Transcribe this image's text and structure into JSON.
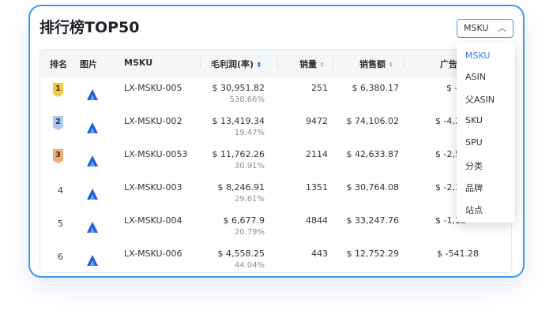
{
  "title": "排行榜TOP50",
  "selector": {
    "value": "MSKU"
  },
  "columns": {
    "rank": "排名",
    "image": "图片",
    "msku": "MSKU",
    "margin": "毛利润(率)",
    "qty": "销量",
    "sales": "销售额",
    "ad": "广告"
  },
  "rows": [
    {
      "rank": "1",
      "msku": "LX-MSKU-005",
      "profit": "$ 30,951.82",
      "rate": "538.66%",
      "qty": "251",
      "sales": "$ 6,380.17",
      "ad": "$ -18"
    },
    {
      "rank": "2",
      "msku": "LX-MSKU-002",
      "profit": "$ 13,419.34",
      "rate": "19.47%",
      "qty": "9472",
      "sales": "$ 74,106.02",
      "ad": "$ -4,20"
    },
    {
      "rank": "3",
      "msku": "LX-MSKU-0053",
      "profit": "$ 11,762.26",
      "rate": "30.91%",
      "qty": "2114",
      "sales": "$ 42,633.87",
      "ad": "$ -2,54"
    },
    {
      "rank": "4",
      "msku": "LX-MSKU-003",
      "profit": "$ 8,246.91",
      "rate": "29.61%",
      "qty": "1351",
      "sales": "$ 30,764.08",
      "ad": "$ -2,16"
    },
    {
      "rank": "5",
      "msku": "LX-MSKU-004",
      "profit": "$ 6,677.9",
      "rate": "20.79%",
      "qty": "4844",
      "sales": "$ 33,247.76",
      "ad": "$ -1,12"
    },
    {
      "rank": "6",
      "msku": "LX-MSKU-006",
      "profit": "$ 4,558.25",
      "rate": "44.04%",
      "qty": "443",
      "sales": "$ 12,752.29",
      "ad": "$ -541.28"
    }
  ],
  "dropdown": {
    "options": [
      "MSKU",
      "ASIN",
      "父ASIN",
      "SKU",
      "SPU",
      "分类",
      "品牌",
      "站点"
    ],
    "selected": "MSKU"
  },
  "colors": {
    "accent": "#3b9cf5",
    "gold": "#f5c842",
    "silver": "#a9c9f5",
    "bronze": "#f5a87a"
  },
  "icons": {
    "selector": "chevron-up-icon",
    "sort": "sort-icon",
    "product": "product-logo-icon"
  }
}
